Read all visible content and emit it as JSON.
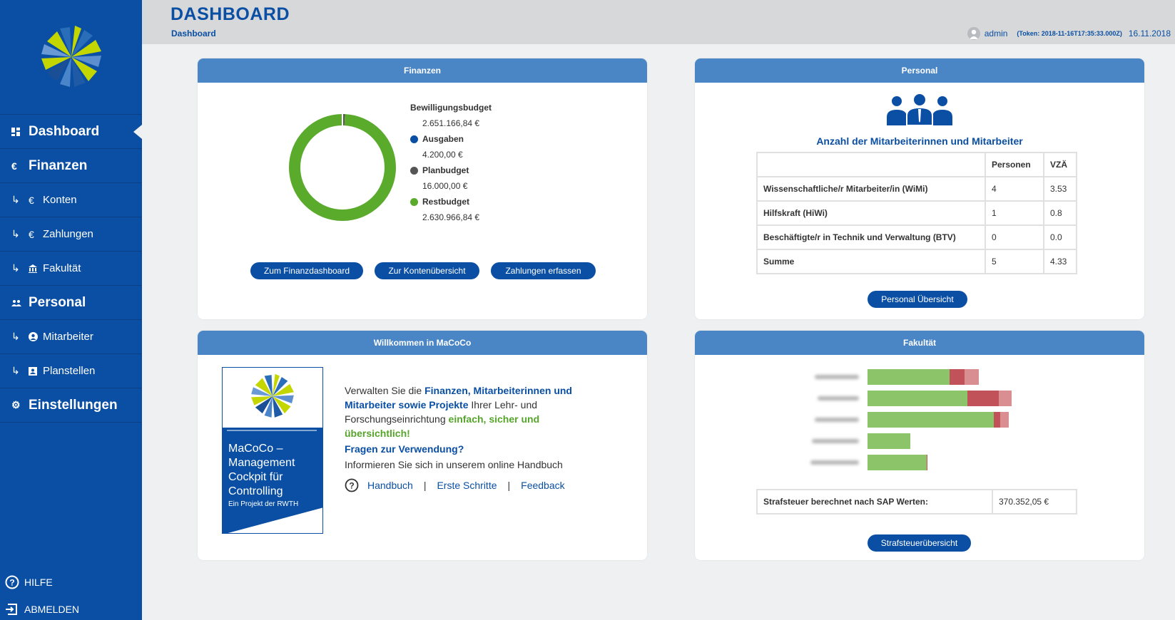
{
  "sidebar": {
    "items": [
      {
        "label": "Dashboard",
        "icon": "dashboard-icon",
        "type": "main",
        "active": true
      },
      {
        "label": "Finanzen",
        "icon": "euro-icon",
        "type": "main"
      },
      {
        "label": "Konten",
        "icon": "euro-icon",
        "type": "sub"
      },
      {
        "label": "Zahlungen",
        "icon": "euro-icon",
        "type": "sub"
      },
      {
        "label": "Fakultät",
        "icon": "bank-icon",
        "type": "sub"
      },
      {
        "label": "Personal",
        "icon": "people-icon",
        "type": "main"
      },
      {
        "label": "Mitarbeiter",
        "icon": "person-icon",
        "type": "sub"
      },
      {
        "label": "Planstellen",
        "icon": "id-card-icon",
        "type": "sub"
      },
      {
        "label": "Einstellungen",
        "icon": "gear-icon",
        "type": "main"
      }
    ],
    "help": "HILFE",
    "logout": "ABMELDEN"
  },
  "header": {
    "title": "DASHBOARD",
    "breadcrumb": "Dashboard",
    "user": "admin",
    "token": "(Token: 2018-11-16T17:35:33.000Z)",
    "date": "16.11.2018"
  },
  "finanzen": {
    "title": "Finanzen",
    "legend": {
      "bewilligung_label": "Bewilligungsbudget",
      "bewilligung_value": "2.651.166,84 €",
      "ausgaben_label": "Ausgaben",
      "ausgaben_value": "4.200,00 €",
      "plan_label": "Planbudget",
      "plan_value": "16.000,00 €",
      "rest_label": "Restbudget",
      "rest_value": "2.630.966,84 €"
    },
    "colors": {
      "ausgaben": "#0a4fa3",
      "plan": "#555555",
      "rest": "#5aaa2c"
    },
    "buttons": {
      "dashboard": "Zum Finanzdashboard",
      "konten": "Zur Kontenübersicht",
      "zahlungen": "Zahlungen erfassen"
    }
  },
  "chart_data": {
    "type": "pie",
    "categories": [
      "Ausgaben",
      "Planbudget",
      "Restbudget"
    ],
    "values": [
      4200.0,
      16000.0,
      2630966.84
    ]
  },
  "personal": {
    "title": "Personal",
    "subtitle": "Anzahl der Mitarbeiterinnen und Mitarbeiter",
    "headers": [
      "",
      "Personen",
      "VZÄ"
    ],
    "rows": [
      [
        "Wissenschaftliche/r Mitarbeiter/in (WiMi)",
        "4",
        "3.53"
      ],
      [
        "Hilfskraft (HiWi)",
        "1",
        "0.8"
      ],
      [
        "Beschäftigte/r in Technik und Verwaltung (BTV)",
        "0",
        "0.0"
      ],
      [
        "Summe",
        "5",
        "4.33"
      ]
    ],
    "button": "Personal Übersicht"
  },
  "welcome": {
    "title": "Willkommen in MaCoCo",
    "logo_text": "MaCoCo – Management Cockpit für Controlling",
    "logo_sub": "Ein Projekt der RWTH",
    "p1_a": "Verwalten Sie die ",
    "p1_b": "Finanzen, Mitarbeiterinnen und Mitarbeiter sowie Projekte",
    "p1_c": " Ihrer Lehr- und Forschungseinrichtung ",
    "p1_d": "einfach, sicher und übersichtlich!",
    "question": "Fragen zur Verwendung?",
    "info": "Informieren Sie sich in unserem online Handbuch",
    "links": {
      "handbuch": "Handbuch",
      "erste": "Erste Schritte",
      "feedback": "Feedback",
      "sep": "|"
    }
  },
  "fakultaet": {
    "title": "Fakultät",
    "bars": [
      [
        0.5,
        0.09,
        0.09
      ],
      [
        0.61,
        0.19,
        0.08
      ],
      [
        0.77,
        0.04,
        0.05
      ],
      [
        0.26,
        0,
        0
      ],
      [
        0.36,
        0.005,
        0
      ]
    ],
    "bar_colors": [
      "#8cc46a",
      "#c1525a",
      "#d98f92"
    ],
    "steuer_label": "Strafsteuer berechnet nach SAP Werten:",
    "steuer_value": "370.352,05 €",
    "button": "Strafsteuerübersicht"
  }
}
